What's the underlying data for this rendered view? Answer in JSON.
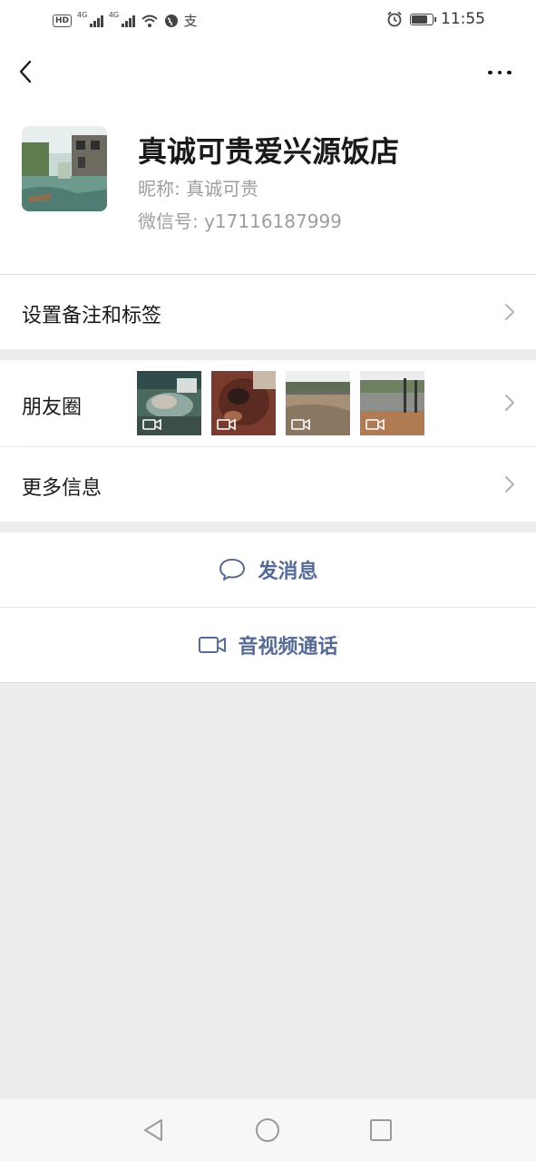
{
  "status_bar": {
    "hd_label": "HD",
    "net_tag_1": "4G",
    "net_tag_2": "4G",
    "alipay_glyph": "支",
    "time": "11:55",
    "battery_level": 0.7,
    "icons": [
      "hd-icon",
      "signal-icon",
      "signal-icon",
      "wifi-icon",
      "globe-icon",
      "alipay-icon",
      "alarm-icon",
      "battery-icon"
    ]
  },
  "header": {
    "back_icon": "chevron-left-icon",
    "more_icon": "more-dots-icon"
  },
  "profile": {
    "name": "真诚可贵爱兴源饭店",
    "nickname": "昵称:  真诚可贵",
    "wechat_id": "微信号:  y17116187999"
  },
  "rows": {
    "remark_tags": "设置备注和标签",
    "moments": "朋友圈",
    "more_info": "更多信息"
  },
  "moments_thumbs": [
    {
      "desc": "video-thumbnail-hands",
      "type": "video"
    },
    {
      "desc": "video-thumbnail-food",
      "type": "video"
    },
    {
      "desc": "video-thumbnail-river",
      "type": "video"
    },
    {
      "desc": "video-thumbnail-street",
      "type": "video"
    }
  ],
  "actions": {
    "send_message": "发消息",
    "video_call": "音视频通话"
  },
  "nav": {
    "back_icon": "nav-back-icon",
    "home_icon": "nav-home-icon",
    "recents_icon": "nav-recents-icon"
  },
  "colors": {
    "link_blue": "#576b95",
    "background_gray": "#ededed",
    "secondary_text": "#9e9e9e"
  }
}
